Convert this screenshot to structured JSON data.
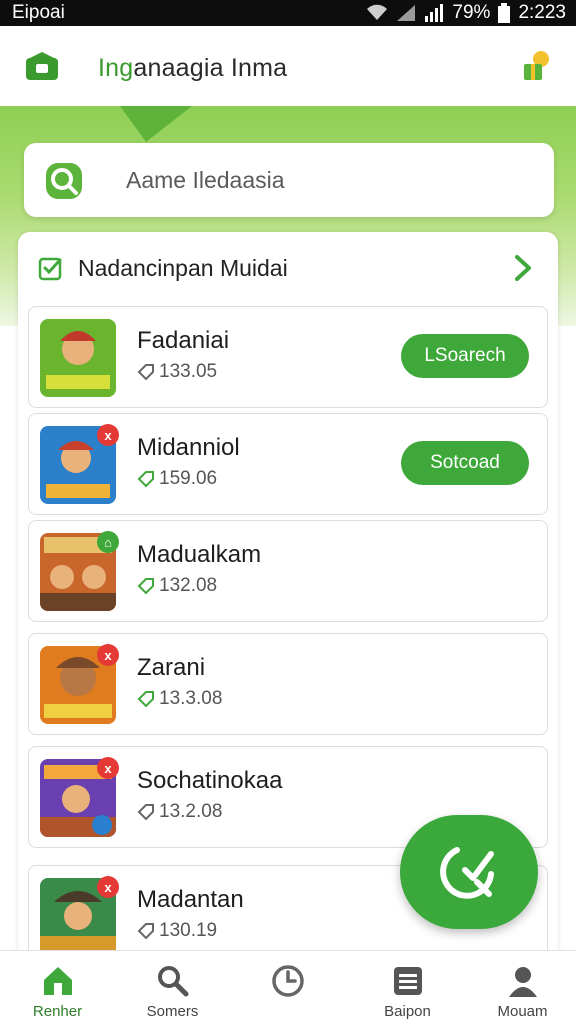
{
  "status_bar": {
    "carrier": "Eipoai",
    "battery": "79%",
    "time": "2:223"
  },
  "app_bar": {
    "title_green": "Ing",
    "title_rest": "anaagia Inma",
    "icon": "home-lock-icon",
    "action_icon": "gift-icon"
  },
  "search": {
    "placeholder": "Aame Iledaasia",
    "icon": "search-icon"
  },
  "section": {
    "title": "Nadancinpan Muidai",
    "icon": "check-icon",
    "action_icon": "chevron-right-icon"
  },
  "items": [
    {
      "name": "Fadaniai",
      "meta": "133.05",
      "button": "LSoarech",
      "badge": "",
      "thumb_colors": [
        "#6ab42e",
        "#d7e03a"
      ]
    },
    {
      "name": "Midanniol",
      "meta": "159.06",
      "button": "Sotcoad",
      "badge": "x",
      "thumb_colors": [
        "#2c7fc9",
        "#f0b33a"
      ]
    },
    {
      "name": "Madualkam",
      "meta": "132.08",
      "button": "",
      "badge": "⌂",
      "thumb_colors": [
        "#c9662c",
        "#e8c26a"
      ]
    },
    {
      "name": "Zarani",
      "meta": "13.3.08",
      "button": "",
      "badge": "x",
      "thumb_colors": [
        "#e07b1f",
        "#f1cf41"
      ]
    },
    {
      "name": "Sochatinokaa",
      "meta": "13.2.08",
      "button": "",
      "badge": "x",
      "thumb_colors": [
        "#6a3fb0",
        "#f2a83a"
      ]
    },
    {
      "name": "Madantan",
      "meta": "130.19",
      "button": "",
      "badge": "x",
      "thumb_colors": [
        "#3a8a4a",
        "#d59a2a"
      ]
    }
  ],
  "fab": {
    "icon": "phone-check-icon"
  },
  "nav": [
    {
      "label": "Renher",
      "icon": "home-icon",
      "active": true
    },
    {
      "label": "Somers",
      "icon": "search-icon",
      "active": false
    },
    {
      "label": "",
      "icon": "clock-icon",
      "active": false
    },
    {
      "label": "Baipon",
      "icon": "list-icon",
      "active": false
    },
    {
      "label": "Mouam",
      "icon": "user-icon",
      "active": false
    }
  ],
  "colors": {
    "accent": "#3ea83a",
    "band_top": "#8fcf55",
    "text": "#222222"
  }
}
